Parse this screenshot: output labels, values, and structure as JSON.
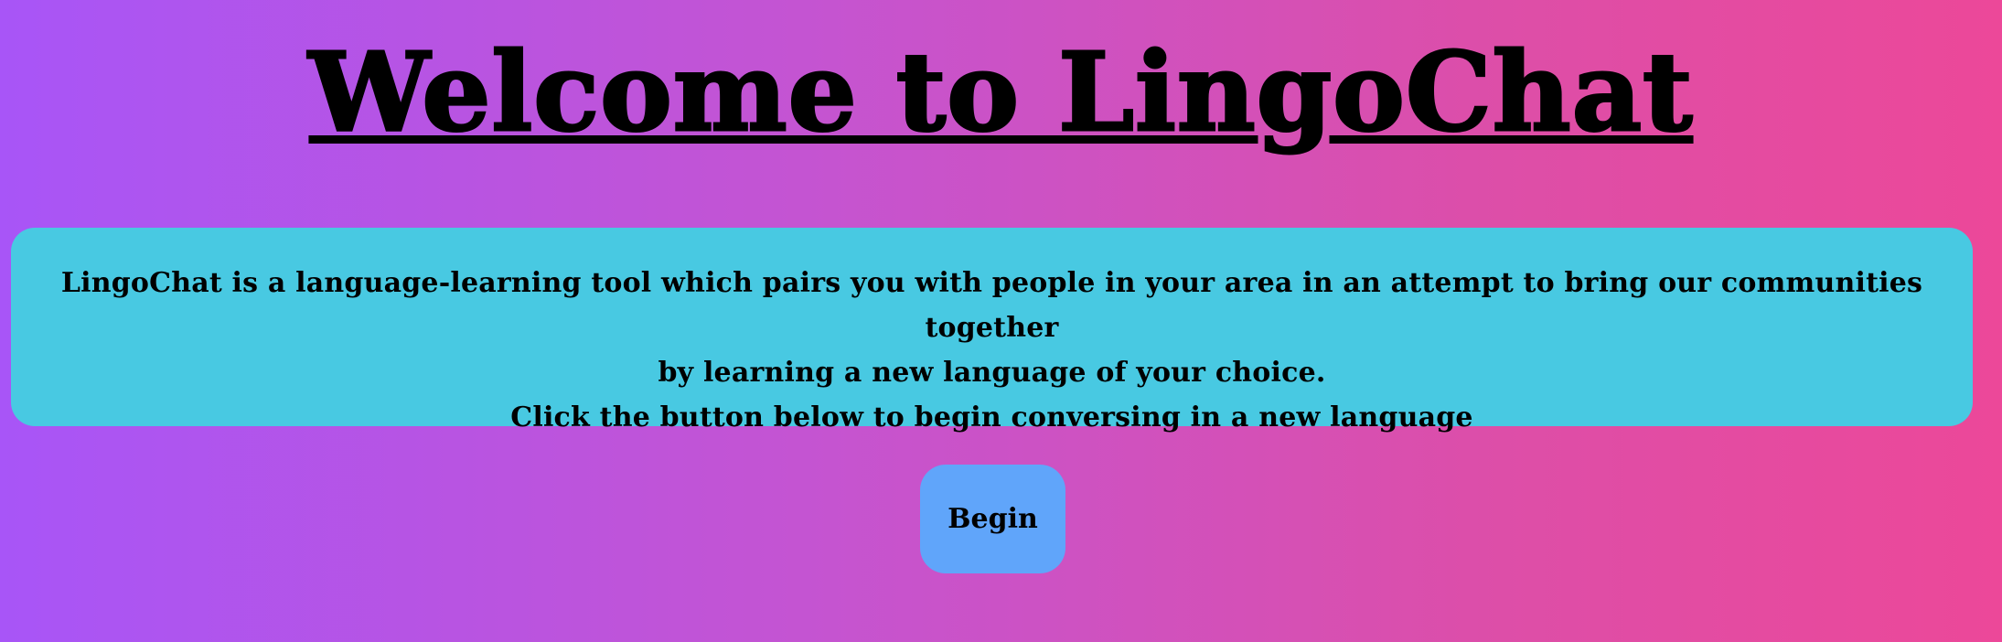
{
  "page": {
    "title": "Welcome to LingoChat"
  },
  "intro": {
    "line1": "LingoChat is a language-learning tool which pairs you with people in your area in an attempt to bring our communities together",
    "line2": "by learning a new language of your choice.",
    "line3": "Click the button below to begin conversing in a new language"
  },
  "actions": {
    "begin_label": "Begin"
  },
  "colors": {
    "gradient_start": "#a855f7",
    "gradient_end": "#ec4899",
    "panel_background": "#48c9e2",
    "button_background": "#60a5fa",
    "text": "#000000"
  }
}
